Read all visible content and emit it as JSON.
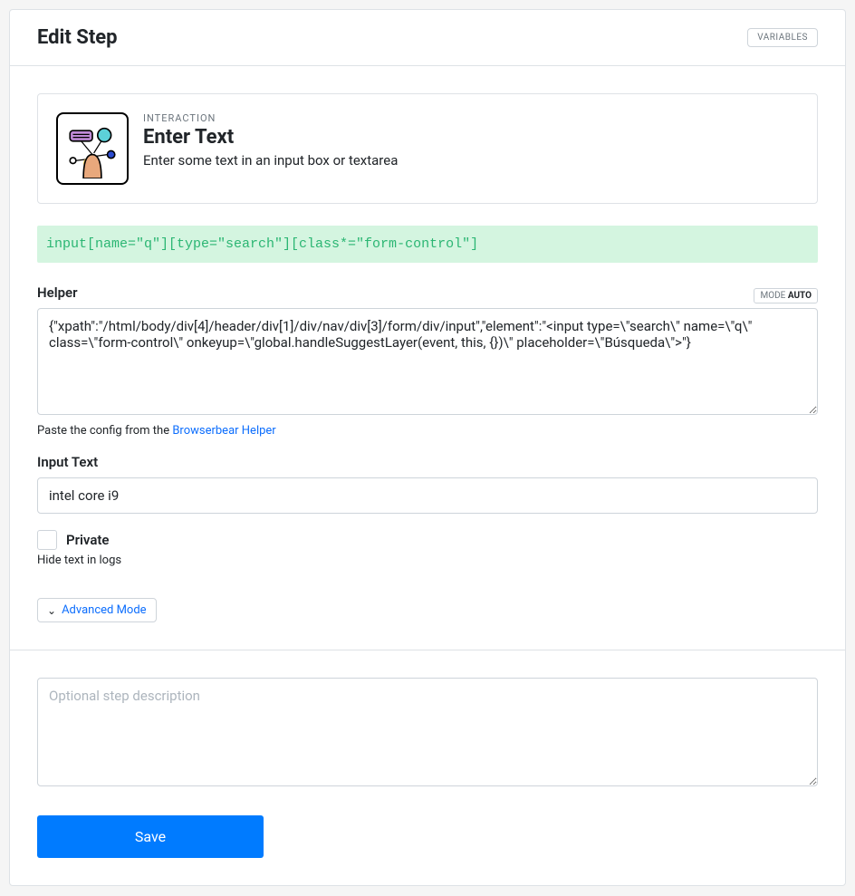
{
  "header": {
    "title": "Edit Step",
    "variables_button": "VARIABLES"
  },
  "interaction": {
    "category": "INTERACTION",
    "title": "Enter Text",
    "description": "Enter some text in an input box or textarea"
  },
  "selector": "input[name=\"q\"][type=\"search\"][class*=\"form-control\"]",
  "helper": {
    "label": "Helper",
    "mode_label": "MODE",
    "mode_value": "AUTO",
    "value": "{\"xpath\":\"/html/body/div[4]/header/div[1]/div/nav/div[3]/form/div/input\",\"element\":\"<input type=\\\"search\\\" name=\\\"q\\\" class=\\\"form-control\\\" onkeyup=\\\"global.handleSuggestLayer(event, this, {})\\\" placeholder=\\\"Búsqueda\\\">\"}",
    "hint_prefix": "Paste the config from the ",
    "hint_link": "Browserbear Helper"
  },
  "input_text": {
    "label": "Input Text",
    "value": "intel core i9"
  },
  "private": {
    "label": "Private",
    "hint": "Hide text in logs"
  },
  "advanced": {
    "label": "Advanced Mode"
  },
  "description": {
    "placeholder": "Optional step description"
  },
  "save_button": "Save"
}
